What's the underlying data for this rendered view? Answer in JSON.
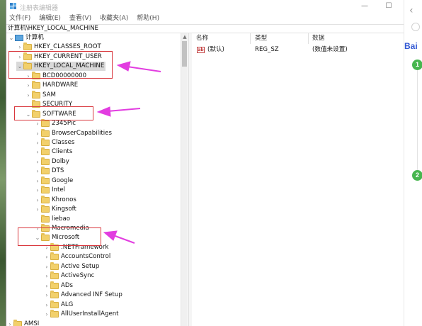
{
  "window": {
    "title": "注册表编辑器",
    "minimize_glyph": "—",
    "maximize_glyph": "☐"
  },
  "menubar": {
    "items": [
      {
        "label": "文件(F)"
      },
      {
        "label": "编辑(E)"
      },
      {
        "label": "查看(V)"
      },
      {
        "label": "收藏夹(A)"
      },
      {
        "label": "帮助(H)"
      }
    ]
  },
  "address": "计算机\\HKEY_LOCAL_MACHINE",
  "tree": {
    "root": "计算机",
    "nodes": [
      {
        "label": "HKEY_CLASSES_ROOT",
        "state": "collapsed"
      },
      {
        "label": "HKEY_CURRENT_USER",
        "state": "collapsed"
      },
      {
        "label": "HKEY_LOCAL_MACHINE",
        "state": "expanded",
        "selected": true
      },
      {
        "label": "BCD00000000",
        "state": "collapsed"
      },
      {
        "label": "HARDWARE",
        "state": "collapsed"
      },
      {
        "label": "SAM",
        "state": "collapsed"
      },
      {
        "label": "SECURITY",
        "state": "none"
      },
      {
        "label": "SOFTWARE",
        "state": "expanded"
      },
      {
        "label": "2345Pic",
        "state": "collapsed"
      },
      {
        "label": "BrowserCapabilities",
        "state": "collapsed"
      },
      {
        "label": "Classes",
        "state": "collapsed"
      },
      {
        "label": "Clients",
        "state": "collapsed"
      },
      {
        "label": "Dolby",
        "state": "collapsed"
      },
      {
        "label": "DTS",
        "state": "collapsed"
      },
      {
        "label": "Google",
        "state": "collapsed"
      },
      {
        "label": "Intel",
        "state": "collapsed"
      },
      {
        "label": "Khronos",
        "state": "collapsed"
      },
      {
        "label": "Kingsoft",
        "state": "collapsed"
      },
      {
        "label": "liebao",
        "state": "none"
      },
      {
        "label": "Macromedia",
        "state": "collapsed"
      },
      {
        "label": "Microsoft",
        "state": "expanded"
      },
      {
        "label": ".NETFramework",
        "state": "collapsed"
      },
      {
        "label": "AccountsControl",
        "state": "collapsed"
      },
      {
        "label": "Active Setup",
        "state": "collapsed"
      },
      {
        "label": "ActiveSync",
        "state": "collapsed"
      },
      {
        "label": "ADs",
        "state": "collapsed"
      },
      {
        "label": "Advanced INF Setup",
        "state": "collapsed"
      },
      {
        "label": "ALG",
        "state": "collapsed"
      },
      {
        "label": "AllUserInstallAgent",
        "state": "collapsed"
      },
      {
        "label": "AMSI",
        "state": "collapsed"
      }
    ]
  },
  "values_pane": {
    "headers": {
      "name": "名称",
      "type": "类型",
      "data": "数据"
    },
    "rows": [
      {
        "icon": "string-value-icon",
        "icon_text": "ab",
        "name": "(默认)",
        "type": "REG_SZ",
        "data": "(数值未设置)"
      }
    ]
  },
  "browser_strip": {
    "back_glyph": "‹",
    "logo_part1": "Bai",
    "logo_part2": "",
    "step1": "1",
    "step2": "2"
  },
  "annotation_colors": {
    "box": "#d9373d",
    "arrow": "#e23de0"
  }
}
